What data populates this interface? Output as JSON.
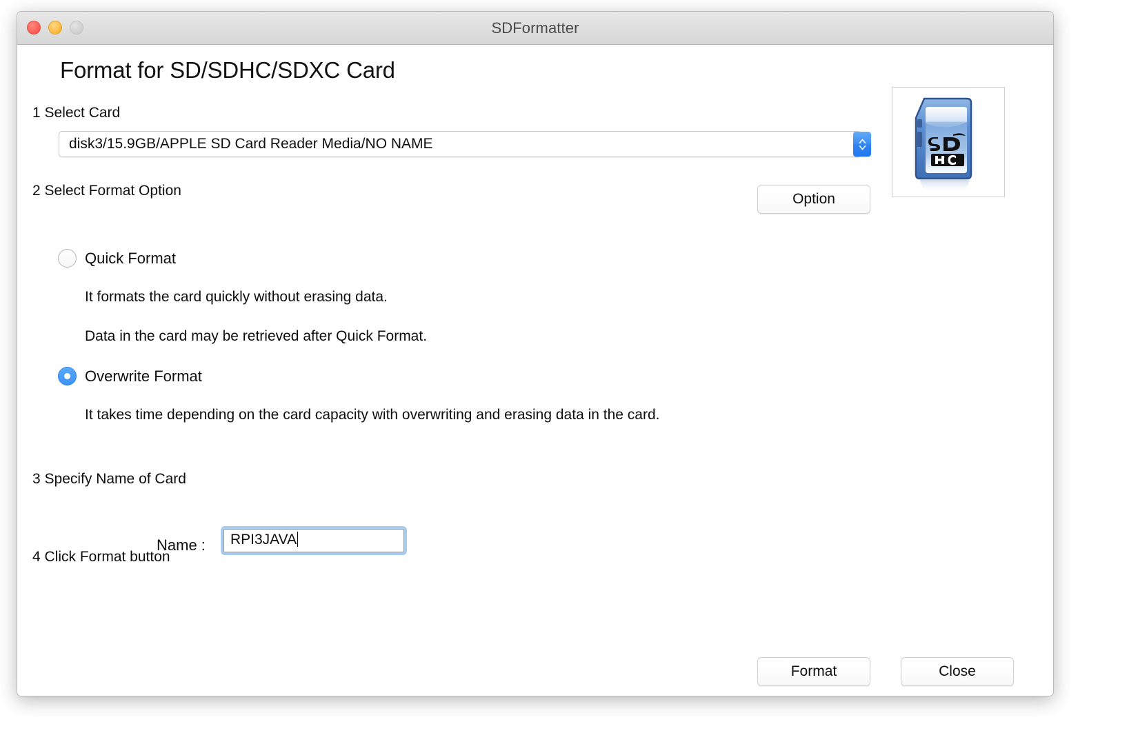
{
  "window": {
    "title": "SDFormatter",
    "traffic_lights": [
      "close",
      "minimize",
      "maximize"
    ]
  },
  "heading": "Format for SD/SDHC/SDXC Card",
  "steps": {
    "step1": "1 Select Card",
    "step2": "2 Select Format Option",
    "step3": "3 Specify Name of Card",
    "step4": "4 Click Format button"
  },
  "card_select": {
    "value": "disk3/15.9GB/APPLE SD Card Reader Media/NO NAME",
    "options": [
      "disk3/15.9GB/APPLE SD Card Reader Media/NO NAME"
    ]
  },
  "option_button": "Option",
  "format_options": {
    "quick": {
      "label": "Quick Format",
      "selected": false,
      "desc1": "It formats the card quickly without erasing data.",
      "desc2": "Data in the card may be retrieved after Quick Format."
    },
    "overwrite": {
      "label": "Overwrite Format",
      "selected": true,
      "desc1": "It takes time depending on the card capacity with overwriting and erasing data in the card."
    }
  },
  "name_field": {
    "label": "Name :",
    "value": "RPI3JAVA",
    "placeholder": ""
  },
  "buttons": {
    "format": "Format",
    "close": "Close"
  },
  "card_image": {
    "logo_top": "SD",
    "logo_bottom": "HC"
  },
  "colors": {
    "accent_blue": "#3d93f5",
    "focus_ring": "#a8cbf0",
    "titlebar_top": "#e8e8e8",
    "titlebar_bottom": "#d6d6d6",
    "close_light": "#fb6057",
    "min_light": "#fdbc40",
    "max_light": "#d2d2d2"
  }
}
